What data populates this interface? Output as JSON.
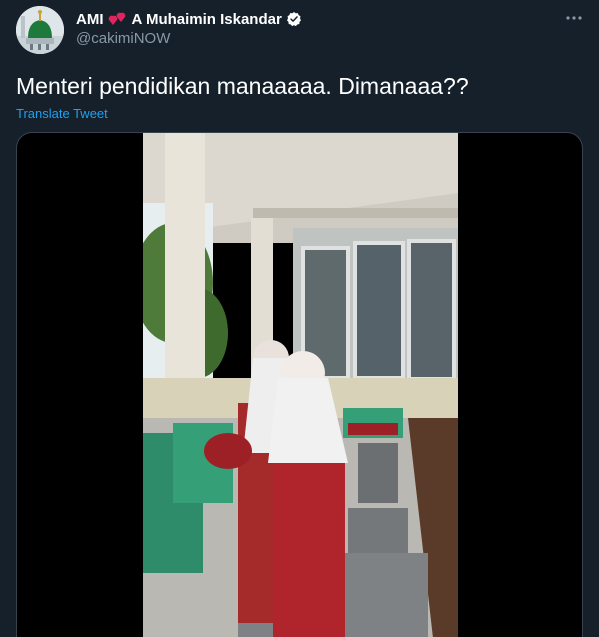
{
  "author": {
    "display_name": "AMI",
    "name_suffix": "A Muhaimin Iskandar",
    "handle": "@cakimiNOW",
    "verified": true,
    "avatar_icon": "mosque-dome-icon"
  },
  "tweet": {
    "text": "Menteri pendidikan manaaaaa. Dimanaaa??",
    "translate_label": "Translate Tweet"
  },
  "media": {
    "type": "video",
    "description_icon": "video-thumbnail"
  },
  "colors": {
    "background": "#15202b",
    "link": "#1da1f2",
    "secondary_text": "#8899a6",
    "border": "#38444d",
    "emoji_hearts": "#e0245e"
  }
}
